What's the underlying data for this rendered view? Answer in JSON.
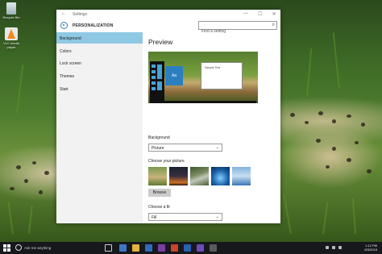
{
  "desktop": {
    "icons": [
      {
        "label": "Recycle Bin"
      },
      {
        "label": "VLC media player"
      }
    ]
  },
  "window": {
    "title": "Settings",
    "back_glyph": "←",
    "controls": {
      "minimize": "—",
      "maximize": "☐",
      "close": "✕"
    }
  },
  "header": {
    "section": "PERSONALIZATION",
    "search_placeholder": "Find a setting",
    "search_icon": "search-icon"
  },
  "nav": {
    "items": [
      {
        "label": "Background",
        "active": true
      },
      {
        "label": "Colors"
      },
      {
        "label": "Lock screen"
      },
      {
        "label": "Themes"
      },
      {
        "label": "Start"
      }
    ]
  },
  "content": {
    "preview_heading": "Preview",
    "preview": {
      "tile_text": "Aa",
      "window_text": "Sample Text"
    },
    "background_label": "Background",
    "background_value": "Picture",
    "choose_picture_label": "Choose your picture",
    "browse_label": "Browse",
    "fit_label": "Choose a fit",
    "fit_value": "Fill"
  },
  "taskbar": {
    "search_text": "Ask me anything",
    "time": "1:12 PM",
    "date": "8/3/2015"
  },
  "colors": {
    "accent": "#8fc8e3",
    "window_bg": "#ffffff",
    "nav_bg": "#f2f2f2",
    "taskbar_bg": "#16181c"
  }
}
